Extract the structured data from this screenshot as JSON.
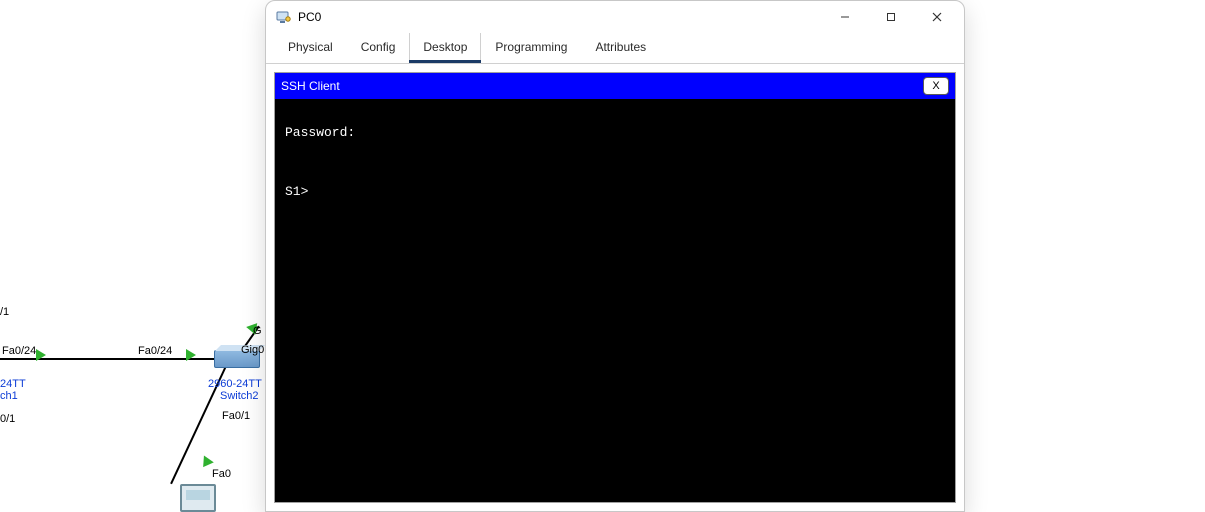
{
  "window": {
    "title": "PC0"
  },
  "tabs": {
    "physical": "Physical",
    "config": "Config",
    "desktop": "Desktop",
    "programming": "Programming",
    "attributes": "Attributes"
  },
  "panel": {
    "title": "SSH Client",
    "close": "X"
  },
  "terminal": {
    "line1": "Password:",
    "line2": "",
    "line3": "",
    "line4": "S1>"
  },
  "topology": {
    "port_partial_left": "/1",
    "port_fa0_24_a": "Fa0/24",
    "port_fa0_24_b": "Fa0/24",
    "port_gig0_partial": "Gig0",
    "dev_24tt_a": "24TT",
    "dev_ch1": "ch1",
    "dev_01": "0/1",
    "dev_2960_24tt": "2960-24TT",
    "dev_switch2": "Switch2",
    "port_fa0_1": "Fa0/1",
    "port_fa0": "Fa0"
  }
}
